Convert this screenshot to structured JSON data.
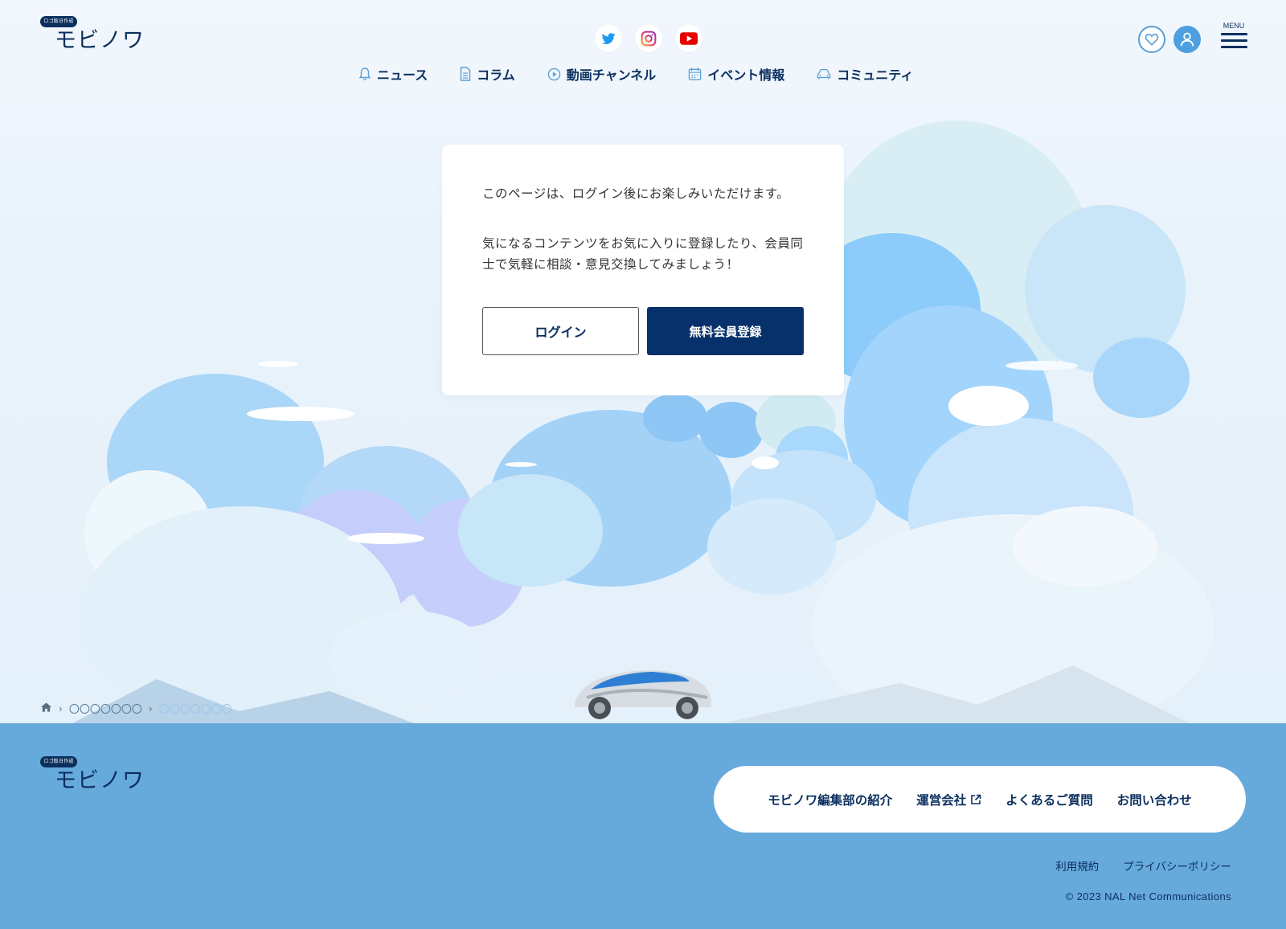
{
  "header": {
    "logo_tag": "ロゴ版日作成",
    "logo_name": "モビノワ",
    "menu_label": "MENU"
  },
  "social": [
    "twitter-icon",
    "instagram-icon",
    "youtube-icon"
  ],
  "nav": {
    "items": [
      {
        "label": "ニュース",
        "icon": "bell-icon"
      },
      {
        "label": "コラム",
        "icon": "document-icon"
      },
      {
        "label": "動画チャンネル",
        "icon": "play-icon"
      },
      {
        "label": "イベント情報",
        "icon": "calendar-icon"
      },
      {
        "label": "コミュニティ",
        "icon": "car-icon"
      }
    ]
  },
  "card": {
    "message1": "このページは、ログイン後にお楽しみいただけます。",
    "message2": "気になるコンテンツをお気に入りに登録したり、会員同士で気軽に相談・意見交換してみましょう！",
    "login_label": "ログイン",
    "register_label": "無料会員登録"
  },
  "breadcrumb": {
    "item1": "〇〇〇〇〇〇〇",
    "item2": "〇〇〇〇〇〇〇"
  },
  "footer": {
    "logo_tag": "ロゴ版日作成",
    "logo_name": "モビノワ",
    "links": [
      "モビノワ編集部の紹介",
      "運営会社",
      "よくあるご質問",
      "お問い合わせ"
    ],
    "terms": "利用規約",
    "privacy": "プライバシーポリシー",
    "copyright": "© 2023 NAL Net Communications"
  },
  "colors": {
    "navy": "#0b2f5e",
    "register_button": "#06316b",
    "footer_bg": "#66aadc",
    "accent_blue": "#4d9fe0"
  }
}
